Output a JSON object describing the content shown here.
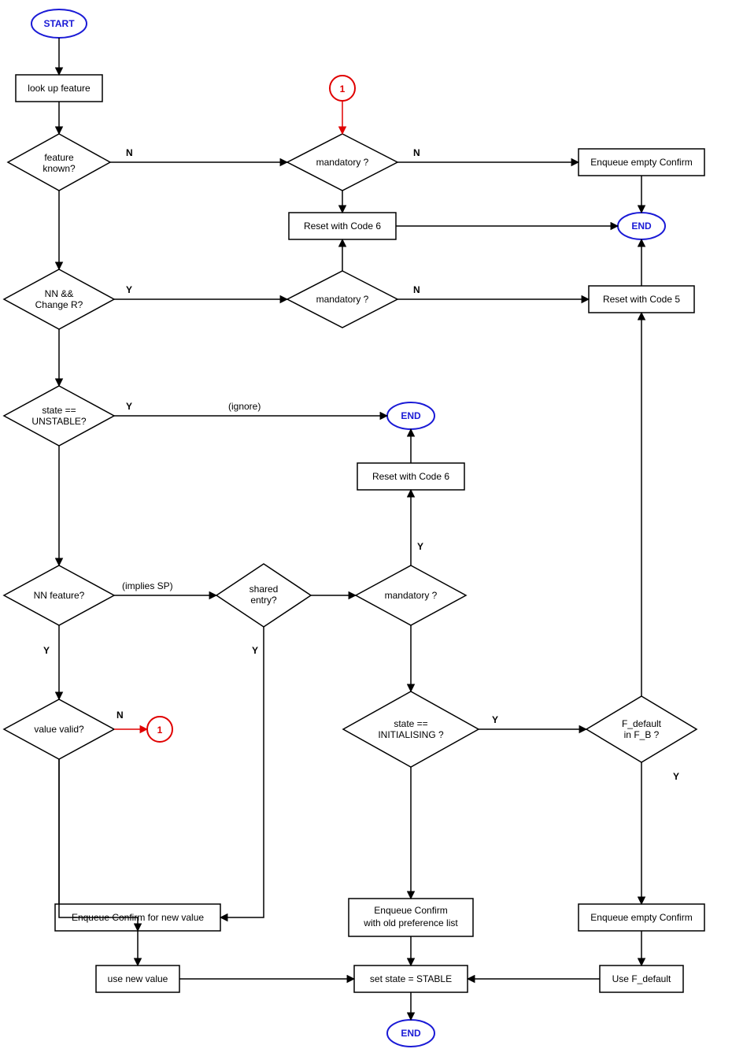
{
  "terminals": {
    "start": "START",
    "end1": "END",
    "end2": "END",
    "end3": "END",
    "conn1a": "1",
    "conn1b": "1"
  },
  "boxes": {
    "lookup": "look up feature",
    "reset6a": "Reset with Code 6",
    "reset6b": "Reset with Code 6",
    "reset5": "Reset with Code 5",
    "enq_empty1": "Enqueue empty Confirm",
    "enq_empty2": "Enqueue empty Confirm",
    "enq_new": "Enqueue Confirm for new value",
    "enq_old1": "Enqueue Confirm",
    "enq_old2": "with old preference list",
    "use_new": "use new value",
    "use_fdef": "Use F_default",
    "set_stable": "set state = STABLE"
  },
  "diamonds": {
    "feature_known1": "feature",
    "feature_known2": "known?",
    "mandatory1": "mandatory ?",
    "nn_change1": "NN  &&",
    "nn_change2": "Change R?",
    "mandatory2": "mandatory ?",
    "state_unstable1": "state ==",
    "state_unstable2": "UNSTABLE?",
    "nn_feature": "NN feature?",
    "shared1": "shared",
    "shared2": "entry?",
    "mandatory3": "mandatory ?",
    "value_valid": "value valid?",
    "state_init1": "state ==",
    "state_init2": "INITIALISING ?",
    "fdef1": "F_default",
    "fdef2": "in F_B ?"
  },
  "labels": {
    "Y": "Y",
    "N": "N",
    "ignore": "(ignore)",
    "implies_sp": "(implies SP)"
  }
}
